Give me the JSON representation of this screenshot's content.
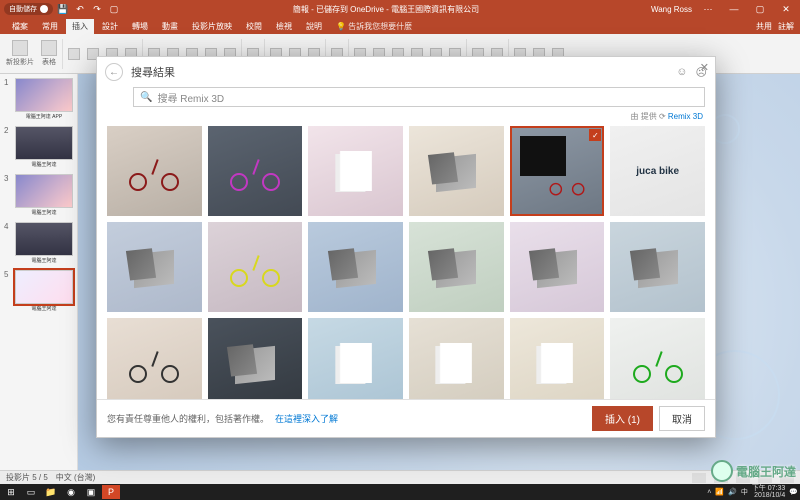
{
  "titlebar": {
    "autosave_label": "自動儲存",
    "doc_title": "簡報 - 已儲存到 OneDrive - 電腦王國際資訊有限公司",
    "user_name": "Wang Ross"
  },
  "ribbon": {
    "tabs": [
      "檔案",
      "常用",
      "插入",
      "設計",
      "轉場",
      "動畫",
      "投影片放映",
      "校閱",
      "檢視",
      "說明"
    ],
    "active_tab_index": 2,
    "tell_me": "告訴我您想要什麼",
    "share": "共用",
    "comment": "註解",
    "groups": {
      "new_slide": "新投影片",
      "table": "表格"
    }
  },
  "thumbs": {
    "slides": [
      {
        "num": "1",
        "caption": "電腦王阿達 APP"
      },
      {
        "num": "2",
        "caption": "電腦王阿達"
      },
      {
        "num": "3",
        "caption": "電腦王阿達"
      },
      {
        "num": "4",
        "caption": "電腦王阿達"
      },
      {
        "num": "5",
        "caption": "電腦王阿達"
      }
    ],
    "selected_index": 4
  },
  "status": {
    "slide_counter": "投影片 5 / 5",
    "language": "中文 (台灣)"
  },
  "dialog": {
    "title": "搜尋結果",
    "search_placeholder": "搜尋 Remix 3D",
    "attribution_prefix": "由 提供",
    "attribution_brand": "Remix 3D",
    "footer_text": "您有責任尊重他人的權利，包括著作權。",
    "footer_link": "在這裡深入了解",
    "insert_label": "插入 (1)",
    "cancel_label": "取消",
    "results": [
      {
        "kind": "bike",
        "color": "#8b1a1a",
        "bg": "bg1"
      },
      {
        "kind": "bike",
        "color": "#c238c2",
        "bg": "bg2"
      },
      {
        "kind": "card",
        "bg": "bg3"
      },
      {
        "kind": "stand",
        "bg": "bg4",
        "extra": "ball"
      },
      {
        "kind": "moto",
        "bg": "bg5",
        "selected": true
      },
      {
        "kind": "text",
        "text": "juca bike",
        "bg": "bg6"
      },
      {
        "kind": "stand",
        "bg": "bg7"
      },
      {
        "kind": "bike",
        "color": "#d8d81e",
        "bg": "bg8"
      },
      {
        "kind": "stand",
        "bg": "bg9"
      },
      {
        "kind": "stand",
        "bg": "bg10"
      },
      {
        "kind": "stand",
        "bg": "bg11"
      },
      {
        "kind": "stand",
        "bg": "bg12"
      },
      {
        "kind": "bike",
        "color": "#333",
        "bg": "bg13"
      },
      {
        "kind": "stand",
        "bg": "bg14"
      },
      {
        "kind": "card",
        "bg": "bg15",
        "extra": "pic"
      },
      {
        "kind": "card",
        "bg": "bg16"
      },
      {
        "kind": "card",
        "bg": "bg17",
        "extra": "bike"
      },
      {
        "kind": "bike",
        "color": "#1eaa1e",
        "bg": "bg18"
      }
    ]
  },
  "taskbar": {
    "time": "下午 07:33",
    "date": "2018/10/4"
  },
  "watermark": {
    "text": "電腦王阿達"
  }
}
